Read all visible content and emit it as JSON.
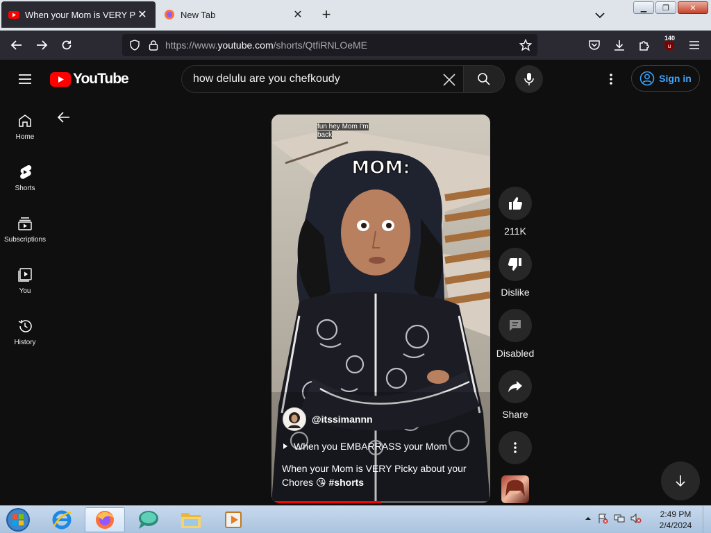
{
  "browser": {
    "tabs": [
      {
        "title": "When your Mom is VERY Picky",
        "active": true
      },
      {
        "title": "New Tab",
        "active": false
      }
    ],
    "url_prefix": "https://www.",
    "url_domain": "youtube.com",
    "url_path": "/shorts/QtfiRNLOeME",
    "extension_badge": "140"
  },
  "youtube": {
    "logo_text": "YouTube",
    "search_query": "how delulu are you chefkoudy",
    "sign_in_label": "Sign in",
    "brand_color": "#ff0000",
    "link_color": "#3ea6ff"
  },
  "sidebar": {
    "items": [
      {
        "label": "Home",
        "icon": "home-icon"
      },
      {
        "label": "Shorts",
        "icon": "shorts-icon"
      },
      {
        "label": "Subscriptions",
        "icon": "subscriptions-icon"
      },
      {
        "label": "You",
        "icon": "you-icon"
      },
      {
        "label": "History",
        "icon": "history-icon"
      }
    ]
  },
  "short": {
    "overlay_caption": "fun hey Mom I'm back",
    "overlay_title": "MOM:",
    "channel_handle": "@itssimannn",
    "sound_title": "When you EMBARRASS your Mom",
    "title_text": "When your Mom is VERY Picky about your Chores 😘 ",
    "title_hashtag": "#shorts",
    "progress": 0.5
  },
  "actions": {
    "like_count": "211K",
    "dislike_label": "Dislike",
    "comments_label": "Disabled",
    "share_label": "Share"
  },
  "taskbar": {
    "clock_time": "2:49 PM",
    "clock_date": "2/4/2024"
  }
}
